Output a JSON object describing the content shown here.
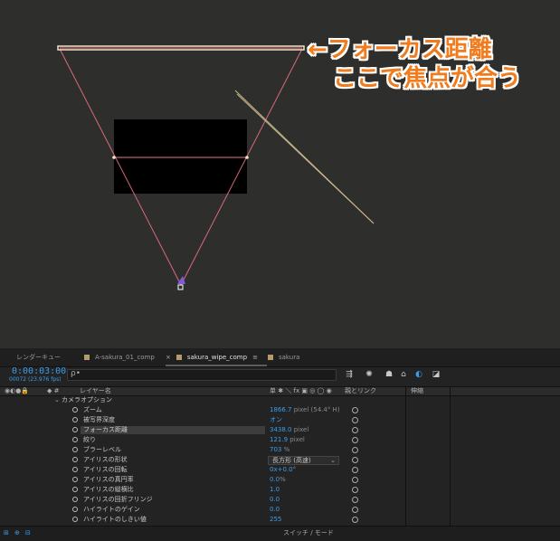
{
  "annotation": {
    "line1": "←フォーカス距離",
    "line2": "ここで焦点が合う"
  },
  "tabs": [
    {
      "label": "レンダーキュー"
    },
    {
      "label": "A-sakura_01_comp"
    },
    {
      "label": "sakura_wipe_comp",
      "close": "×",
      "menu": "≡"
    },
    {
      "label": "sakura"
    }
  ],
  "timeline": {
    "timecode": "0:00:03:00",
    "fps": "00072 (23.976 fps)",
    "search_icon": "ρ•"
  },
  "header": {
    "layer_name": "レイヤー名",
    "switches": "单 ✱ ＼ fx ▣ ◎ ◯ ◉",
    "parent_link": "親とリンク",
    "stretch": "伸縮"
  },
  "group": {
    "label": "カメラオプション"
  },
  "properties": [
    {
      "name": "ズーム",
      "value": "1866.7",
      "unit": " pixel (54.4° H)"
    },
    {
      "name": "被写界深度",
      "value": "オン",
      "unit": ""
    },
    {
      "name": "フォーカス距離",
      "value": "3438.0",
      "unit": " pixel",
      "selected": true
    },
    {
      "name": "絞り",
      "value": "121.9",
      "unit": " pixel"
    },
    {
      "name": "ブラーレベル",
      "value": "703",
      "unit": " %"
    },
    {
      "name": "アイリスの形状",
      "value": "長方形 (高速)",
      "unit": "",
      "dropdown": true
    },
    {
      "name": "アイリスの回転",
      "value": "0x+0.0",
      "unit": "°"
    },
    {
      "name": "アイリスの真円率",
      "value": "0.0",
      "unit": "%"
    },
    {
      "name": "アイリスの縦横比",
      "value": "1.0",
      "unit": ""
    },
    {
      "name": "アイリスの回折フリンジ",
      "value": "0.0",
      "unit": ""
    },
    {
      "name": "ハイライトのゲイン",
      "value": "0.0",
      "unit": ""
    },
    {
      "name": "ハイライトのしきい値",
      "value": "255",
      "unit": ""
    }
  ],
  "footer": {
    "switch_mode": "スイッチ / モード"
  },
  "colors": {
    "accent_blue": "#3b9dea",
    "annotation_orange": "#f07c1e",
    "camera_line": "#e07a8a",
    "motion_path": "#c8b48a"
  }
}
